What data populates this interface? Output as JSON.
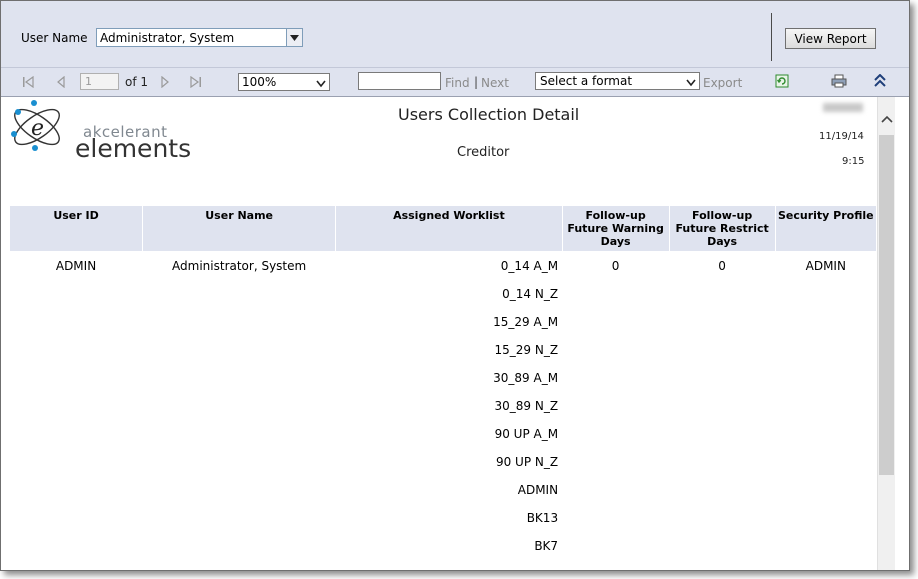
{
  "parameters": {
    "user_name_label": "User Name",
    "user_name_value": "Administrator, System",
    "view_report_label": "View Report"
  },
  "toolbar": {
    "page_number": "1",
    "of_label": "of 1",
    "zoom_value": "100%",
    "find_label": "Find",
    "separator": "|",
    "next_label": "Next",
    "format_placeholder": "Select a format",
    "export_label": "Export",
    "icons": [
      "first-page-icon",
      "previous-page-icon",
      "next-page-icon",
      "last-page-icon",
      "refresh-icon",
      "print-icon",
      "collapse-icon"
    ]
  },
  "report": {
    "logo_word_1": "akcelerant",
    "logo_word_2": "elements",
    "title": "Users Collection Detail",
    "subtitle": "Creditor",
    "date": "11/19/14",
    "time": "9:15",
    "columns": {
      "user_id": "User ID",
      "user_name": "User Name",
      "assigned_worklist": "Assigned Worklist",
      "followup_warning": "Follow-up Future Warning Days",
      "followup_restrict": "Follow-up Future Restrict Days",
      "security_profile": "Security Profile"
    },
    "rows": [
      {
        "user_id": "ADMIN",
        "user_name": "Administrator, System",
        "worklist": "0_14 A_M",
        "warning": "0",
        "restrict": "0",
        "profile": "ADMIN"
      },
      {
        "user_id": "",
        "user_name": "",
        "worklist": "0_14 N_Z",
        "warning": "",
        "restrict": "",
        "profile": ""
      },
      {
        "user_id": "",
        "user_name": "",
        "worklist": "15_29 A_M",
        "warning": "",
        "restrict": "",
        "profile": ""
      },
      {
        "user_id": "",
        "user_name": "",
        "worklist": "15_29 N_Z",
        "warning": "",
        "restrict": "",
        "profile": ""
      },
      {
        "user_id": "",
        "user_name": "",
        "worklist": "30_89 A_M",
        "warning": "",
        "restrict": "",
        "profile": ""
      },
      {
        "user_id": "",
        "user_name": "",
        "worklist": "30_89 N_Z",
        "warning": "",
        "restrict": "",
        "profile": ""
      },
      {
        "user_id": "",
        "user_name": "",
        "worklist": "90 UP A_M",
        "warning": "",
        "restrict": "",
        "profile": ""
      },
      {
        "user_id": "",
        "user_name": "",
        "worklist": "90 UP N_Z",
        "warning": "",
        "restrict": "",
        "profile": ""
      },
      {
        "user_id": "",
        "user_name": "",
        "worklist": "ADMIN",
        "warning": "",
        "restrict": "",
        "profile": ""
      },
      {
        "user_id": "",
        "user_name": "",
        "worklist": "BK13",
        "warning": "",
        "restrict": "",
        "profile": ""
      },
      {
        "user_id": "",
        "user_name": "",
        "worklist": "BK7",
        "warning": "",
        "restrict": "",
        "profile": ""
      }
    ]
  },
  "colors": {
    "toolbar_bg": "#dfe3ef",
    "header_bg": "#dfe3ef",
    "accent_blue": "#1a8fd0",
    "refresh_green": "#2e8b2e"
  }
}
